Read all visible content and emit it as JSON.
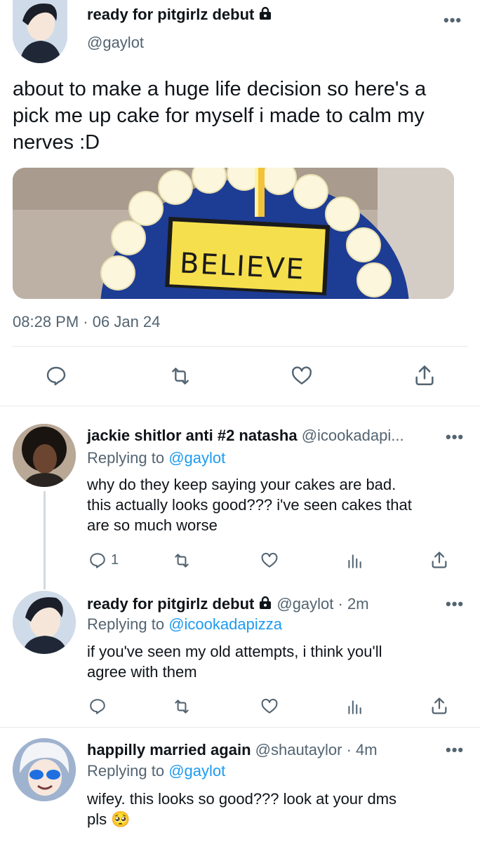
{
  "main_tweet": {
    "display_name": "ready for pitgirlz debut",
    "handle": "@gaylot",
    "text_lines": [
      "about to make a huge life decision so here's a",
      "pick me up cake for myself i made to calm my",
      "nerves :D"
    ],
    "image_text": "BELIEVE",
    "time": "08:28 PM",
    "separator": "·",
    "date": "06 Jan 24",
    "more": "•••"
  },
  "replies": [
    {
      "display_name": "jackie shitlor anti #2 natasha",
      "handle": "@icookadapi...",
      "meta": "",
      "replying_label": "Replying to",
      "replying_to": "@gaylot",
      "text_lines": [
        "why do they keep saying your cakes are bad.",
        "this actually looks good??? i've seen cakes that",
        "are so much worse"
      ],
      "reply_count": "1",
      "more": "•••"
    },
    {
      "display_name": "ready for pitgirlz debut",
      "handle": "@gaylot",
      "meta": "· 2m",
      "replying_label": "Replying to",
      "replying_to": "@icookadapizza",
      "text_lines": [
        "if you've seen my old attempts, i think you'll",
        "agree with them"
      ],
      "reply_count": "",
      "more": "•••"
    },
    {
      "display_name": "happilly married again",
      "handle": "@shautaylor",
      "meta": "· 4m",
      "replying_label": "Replying to",
      "replying_to": "@gaylot",
      "text_lines": [
        "wifey. this looks so good??? look at your dms",
        "pls"
      ],
      "emoji": "🥺",
      "more": "•••"
    }
  ],
  "colors": {
    "link": "#1d9bf0",
    "secondary_text": "#536471",
    "icon": "#536471",
    "divider": "#e6e9ec"
  }
}
